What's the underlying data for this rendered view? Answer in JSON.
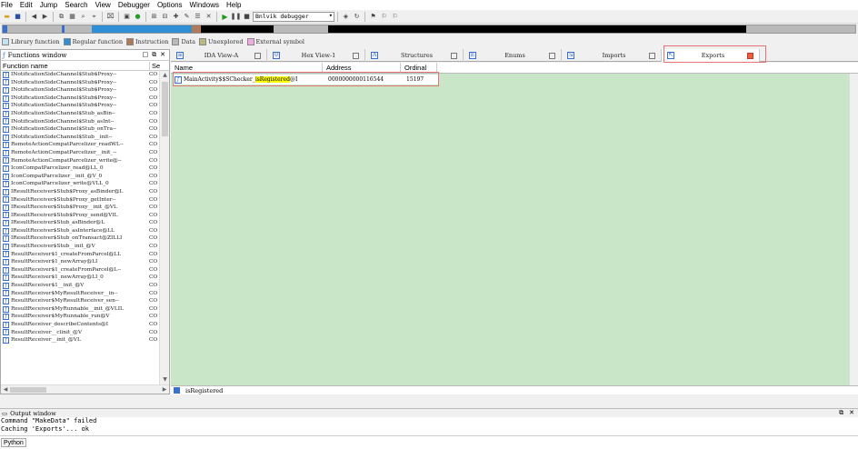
{
  "menubar": {
    "items": [
      "File",
      "Edit",
      "Jump",
      "Search",
      "View",
      "Debugger",
      "Options",
      "Windows",
      "Help"
    ]
  },
  "toolbar": {
    "debugger_select": "Bnlvik debugger"
  },
  "legend": {
    "items": [
      {
        "label": "Library function",
        "color": "#bfe3f2"
      },
      {
        "label": "Regular function",
        "color": "#2e8fd4"
      },
      {
        "label": "Instruction",
        "color": "#b07a5a"
      },
      {
        "label": "Data",
        "color": "#b9b9b9"
      },
      {
        "label": "Unexplored",
        "color": "#b8b880"
      },
      {
        "label": "External symbol",
        "color": "#f2a9e0"
      }
    ]
  },
  "functions_window": {
    "title": "Functions window",
    "column_name": "Function name",
    "column_segment": "Se",
    "items": [
      "INotificationSideChannel$Stub$Proxy--",
      "INotificationSideChannel$Stub$Proxy--",
      "INotificationSideChannel$Stub$Proxy--",
      "INotificationSideChannel$Stub$Proxy--",
      "INotificationSideChannel$Stub$Proxy--",
      "INotificationSideChannel$Stub_asBin--",
      "INotificationSideChannel$Stub_asInt--",
      "INotificationSideChannel$Stub_onTra--",
      "INotificationSideChannel$Stub__init--",
      "RemoteActionCompatParcelizer_readWL--",
      "RemoteActionCompatParcelizer__init_--",
      "RemoteActionCompatParcelizer_write@--",
      "IconCompatParcelizer_read@LL_0",
      "IconCompatParcelizer__init_@V_0",
      "IconCompatParcelizer_write@VLL_0",
      "IResultReceiver$Stub$Proxy_asBinder@L",
      "IResultReceiver$Stub$Proxy_getInter--",
      "IResultReceiver$Stub$Proxy__init_@VL",
      "IResultReceiver$Stub$Proxy_send@VIL",
      "IResultReceiver$Stub_asBinder@L",
      "IResultReceiver$Stub_asInterface@LL",
      "IResultReceiver$Stub_onTransact@ZILLI",
      "IResultReceiver$Stub__init_@V",
      "ResultReceiver$1_createFromParcel@LL",
      "ResultReceiver$1_newArray@LI",
      "ResultReceiver$1_createFromParcel@L--",
      "ResultReceiver$1_newArray@LI_0",
      "ResultReceiver$1__init_@V",
      "ResultReceiver$MyResultReceiver__in--",
      "ResultReceiver$MyResultReceiver_sen--",
      "ResultReceiver$MyRunnable__init_@VLIL",
      "ResultReceiver$MyRunnable_run@V",
      "ResultReceiver_describeContents@I",
      "ResultReceiver__clinit_@V",
      "ResultReceiver__init_@VL"
    ],
    "segment": "CO"
  },
  "tabs": [
    {
      "label": "IDA View-A"
    },
    {
      "label": "Hex View-1"
    },
    {
      "label": "Structures"
    },
    {
      "label": "Enums"
    },
    {
      "label": "Imports"
    },
    {
      "label": "Exports"
    }
  ],
  "exports": {
    "columns": [
      "Name",
      "Address",
      "Ordinal"
    ],
    "row": {
      "name_prefix": "MainActivity$$SChecker_",
      "name_match": "isRegistered",
      "name_suffix": "@I",
      "address": "0000000000116544",
      "ordinal": "15197"
    },
    "search_text": "isRegistered"
  },
  "output_window": {
    "title": "Output window",
    "lines": [
      "Command \"MakeData\" failed",
      "Caching 'Exports'... ok"
    ],
    "language": "Python"
  }
}
